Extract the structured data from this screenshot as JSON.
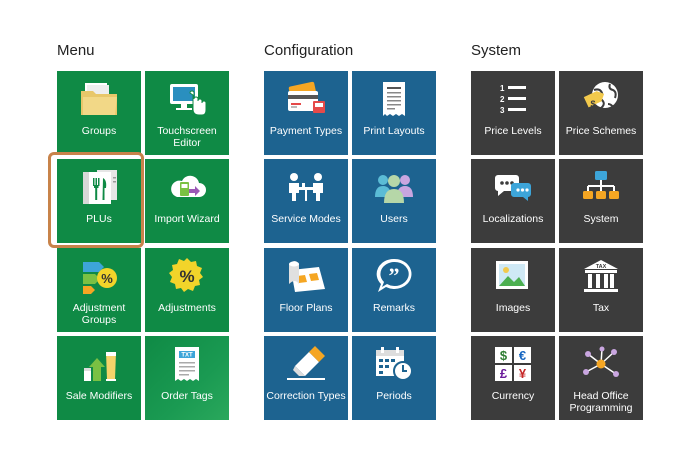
{
  "sections": {
    "menu": "Menu",
    "configuration": "Configuration",
    "system": "System"
  },
  "menu_tiles": [
    {
      "label": "Groups",
      "icon": "folder-icon"
    },
    {
      "label": "Touchscreen\nEditor",
      "icon": "touchscreen-icon"
    },
    {
      "label": "PLUs",
      "icon": "plu-menu-icon"
    },
    {
      "label": "Import Wizard",
      "icon": "cloud-import-icon"
    },
    {
      "label": "Adjustment\nGroups",
      "icon": "adjustment-groups-icon"
    },
    {
      "label": "Adjustments",
      "icon": "percent-badge-icon"
    },
    {
      "label": "Sale Modifiers",
      "icon": "sale-modifiers-icon"
    },
    {
      "label": "Order Tags",
      "icon": "txt-receipt-icon"
    }
  ],
  "configuration_tiles": [
    {
      "label": "Payment Types",
      "icon": "payment-card-icon"
    },
    {
      "label": "Print Layouts",
      "icon": "receipt-icon"
    },
    {
      "label": "Service Modes",
      "icon": "table-people-icon"
    },
    {
      "label": "Users",
      "icon": "users-icon"
    },
    {
      "label": "Floor Plans",
      "icon": "floor-plan-icon"
    },
    {
      "label": "Remarks",
      "icon": "quote-bubble-icon"
    },
    {
      "label": "Correction Types",
      "icon": "eraser-icon"
    },
    {
      "label": "Periods",
      "icon": "calendar-clock-icon"
    }
  ],
  "system_tiles": [
    {
      "label": "Price Levels",
      "icon": "numbered-list-icon"
    },
    {
      "label": "Price Schemes",
      "icon": "globe-tag-icon"
    },
    {
      "label": "Localizations",
      "icon": "chat-bubbles-icon"
    },
    {
      "label": "System",
      "icon": "hierarchy-icon"
    },
    {
      "label": "Images",
      "icon": "image-icon"
    },
    {
      "label": "Tax",
      "icon": "tax-building-icon"
    },
    {
      "label": "Currency",
      "icon": "currency-icon"
    },
    {
      "label": "Head Office\nProgramming",
      "icon": "network-icon"
    }
  ],
  "tax_sign": "TAX",
  "order_tag_sign": "TXT",
  "colors": {
    "menu": "#0f8a45",
    "configuration": "#1d6390",
    "system": "#3c3c3c",
    "selection": "#c8834a"
  },
  "selected_tile": "PLUs"
}
